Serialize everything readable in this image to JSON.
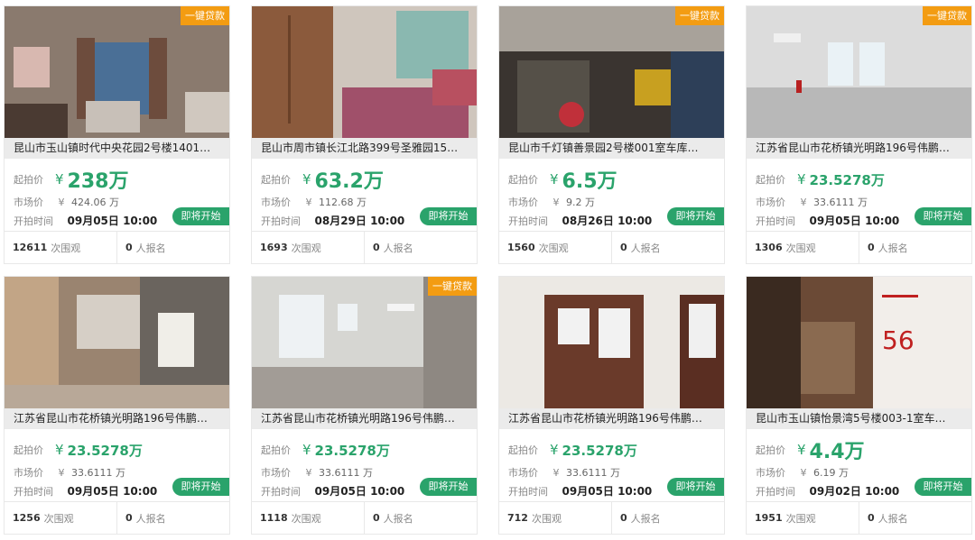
{
  "labels": {
    "start_price": "起拍价",
    "market_price": "市场价",
    "start_time": "开拍时间",
    "currency": "¥",
    "wan": "万",
    "views_suffix": "次围观",
    "signup_suffix": "人报名",
    "loan_tag": "一键贷款",
    "soon_button": "即将开始"
  },
  "colors": {
    "accent_green": "#2aa36b",
    "loan_orange": "#f39c12"
  },
  "listings": [
    {
      "title": "昆山市玉山镇时代中央花园2号楼1401…",
      "price": "238",
      "market": "424.06",
      "time": "09月05日 10:00",
      "views": "12611",
      "signups": "0",
      "loan": true
    },
    {
      "title": "昆山市周市镇长江北路399号圣雅园15…",
      "price": "63.2",
      "market": "112.68",
      "time": "08月29日 10:00",
      "views": "1693",
      "signups": "0",
      "loan": false
    },
    {
      "title": "昆山市千灯镇善景园2号楼001室车库…",
      "price": "6.5",
      "market": "9.2",
      "time": "08月26日 10:00",
      "views": "1560",
      "signups": "0",
      "loan": true
    },
    {
      "title": "江苏省昆山市花桥镇光明路196号伟鹏…",
      "price": "23.5278",
      "market": "33.6111",
      "time": "09月05日 10:00",
      "views": "1306",
      "signups": "0",
      "loan": true
    },
    {
      "title": "江苏省昆山市花桥镇光明路196号伟鹏…",
      "price": "23.5278",
      "market": "33.6111",
      "time": "09月05日 10:00",
      "views": "1256",
      "signups": "0",
      "loan": false
    },
    {
      "title": "江苏省昆山市花桥镇光明路196号伟鹏…",
      "price": "23.5278",
      "market": "33.6111",
      "time": "09月05日 10:00",
      "views": "1118",
      "signups": "0",
      "loan": true
    },
    {
      "title": "江苏省昆山市花桥镇光明路196号伟鹏…",
      "price": "23.5278",
      "market": "33.6111",
      "time": "09月05日 10:00",
      "views": "712",
      "signups": "0",
      "loan": false
    },
    {
      "title": "昆山市玉山镇怡景湾5号楼003-1室车…",
      "price": "4.4",
      "market": "6.19",
      "time": "09月02日 10:00",
      "views": "1951",
      "signups": "0",
      "loan": false
    }
  ]
}
